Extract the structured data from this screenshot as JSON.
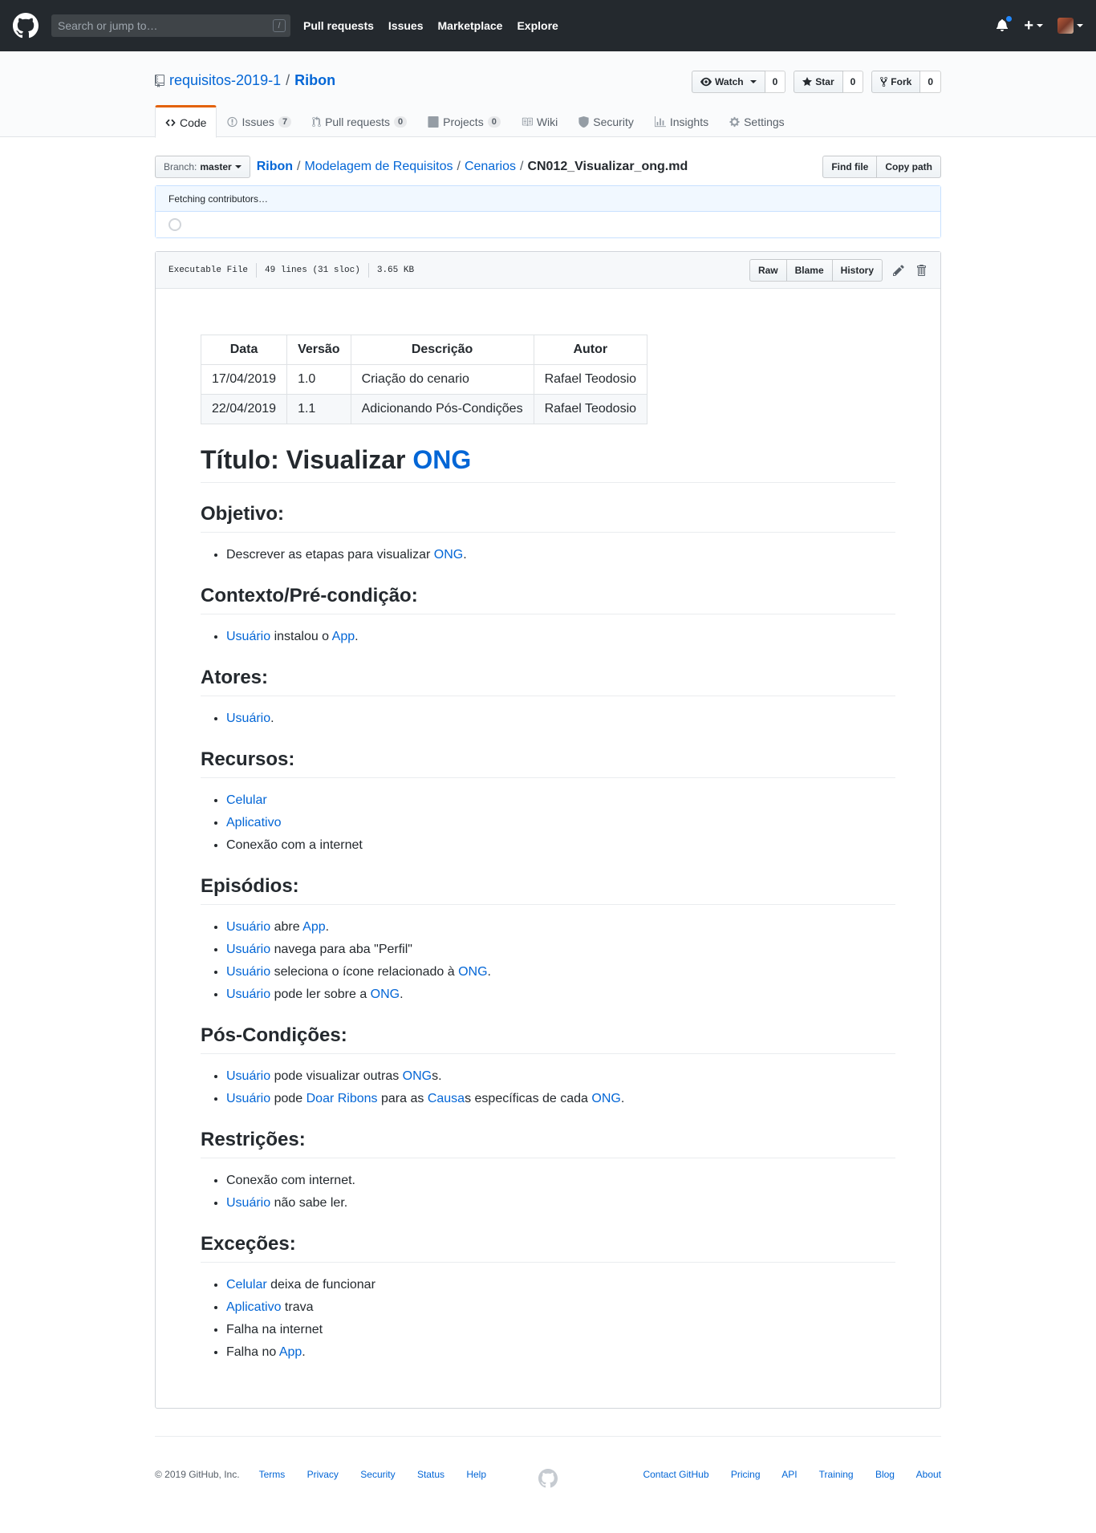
{
  "header": {
    "search_placeholder": "Search or jump to…",
    "search_key": "/",
    "nav": [
      "Pull requests",
      "Issues",
      "Marketplace",
      "Explore"
    ]
  },
  "repo": {
    "owner": "requisitos-2019-1",
    "separator": "/",
    "name": "Ribon",
    "watch_label": "Watch",
    "watch_count": "0",
    "star_label": "Star",
    "star_count": "0",
    "fork_label": "Fork",
    "fork_count": "0",
    "tabs": [
      {
        "label": "Code",
        "icon": "code-icon"
      },
      {
        "label": "Issues",
        "count": "7",
        "icon": "issue-icon"
      },
      {
        "label": "Pull requests",
        "count": "0",
        "icon": "pull-request-icon"
      },
      {
        "label": "Projects",
        "count": "0",
        "icon": "project-icon"
      },
      {
        "label": "Wiki",
        "icon": "book-icon"
      },
      {
        "label": "Security",
        "icon": "shield-icon"
      },
      {
        "label": "Insights",
        "icon": "graph-icon"
      },
      {
        "label": "Settings",
        "icon": "gear-icon"
      }
    ]
  },
  "file_nav": {
    "branch_prefix": "Branch:",
    "branch": "master",
    "path": [
      "Ribon",
      "Modelagem de Requisitos",
      "Cenarios"
    ],
    "sep": "/",
    "file": "CN012_Visualizar_ong.md",
    "find_file": "Find file",
    "copy_path": "Copy path",
    "fetching": "Fetching contributors…"
  },
  "file_header": {
    "mode": "Executable File",
    "lines": "49 lines (31 sloc)",
    "size": "3.65 KB",
    "raw": "Raw",
    "blame": "Blame",
    "history": "History"
  },
  "doc": {
    "table": {
      "headers": [
        "Data",
        "Versão",
        "Descrição",
        "Autor"
      ],
      "rows": [
        [
          "17/04/2019",
          "1.0",
          "Criação do cenario",
          "Rafael Teodosio"
        ],
        [
          "22/04/2019",
          "1.1",
          "Adicionando Pós-Condições",
          "Rafael Teodosio"
        ]
      ]
    },
    "title_prefix": "Título: Visualizar ",
    "title_link": "ONG",
    "sections": [
      {
        "heading": "Objetivo:",
        "items": [
          [
            [
              "t",
              "Descrever as etapas para visualizar "
            ],
            [
              "a",
              "ONG"
            ],
            [
              "t",
              "."
            ]
          ]
        ]
      },
      {
        "heading": "Contexto/Pré-condição:",
        "items": [
          [
            [
              "a",
              "Usuário"
            ],
            [
              "t",
              " instalou o "
            ],
            [
              "a",
              "App"
            ],
            [
              "t",
              "."
            ]
          ]
        ]
      },
      {
        "heading": "Atores:",
        "items": [
          [
            [
              "a",
              "Usuário"
            ],
            [
              "t",
              "."
            ]
          ]
        ]
      },
      {
        "heading": "Recursos:",
        "items": [
          [
            [
              "a",
              "Celular"
            ]
          ],
          [
            [
              "a",
              "Aplicativo"
            ]
          ],
          [
            [
              "t",
              "Conexão com a internet"
            ]
          ]
        ]
      },
      {
        "heading": "Episódios:",
        "items": [
          [
            [
              "a",
              "Usuário"
            ],
            [
              "t",
              " abre "
            ],
            [
              "a",
              "App"
            ],
            [
              "t",
              "."
            ]
          ],
          [
            [
              "a",
              "Usuário"
            ],
            [
              "t",
              " navega para aba \"Perfil\""
            ]
          ],
          [
            [
              "a",
              "Usuário"
            ],
            [
              "t",
              " seleciona o ícone relacionado à "
            ],
            [
              "a",
              "ONG"
            ],
            [
              "t",
              "."
            ]
          ],
          [
            [
              "a",
              "Usuário"
            ],
            [
              "t",
              " pode ler sobre a "
            ],
            [
              "a",
              "ONG"
            ],
            [
              "t",
              "."
            ]
          ]
        ]
      },
      {
        "heading": "Pós-Condições:",
        "items": [
          [
            [
              "a",
              "Usuário"
            ],
            [
              "t",
              " pode visualizar outras "
            ],
            [
              "a",
              "ONG"
            ],
            [
              "t",
              "s."
            ]
          ],
          [
            [
              "a",
              "Usuário"
            ],
            [
              "t",
              " pode "
            ],
            [
              "a",
              "Doar Ribons"
            ],
            [
              "t",
              " para as "
            ],
            [
              "a",
              "Causa"
            ],
            [
              "t",
              "s específicas de cada "
            ],
            [
              "a",
              "ONG"
            ],
            [
              "t",
              "."
            ]
          ]
        ]
      },
      {
        "heading": "Restrições:",
        "items": [
          [
            [
              "t",
              "Conexão com internet."
            ]
          ],
          [
            [
              "a",
              "Usuário"
            ],
            [
              "t",
              " não sabe ler."
            ]
          ]
        ]
      },
      {
        "heading": "Exceções:",
        "items": [
          [
            [
              "a",
              "Celular"
            ],
            [
              "t",
              " deixa de funcionar"
            ]
          ],
          [
            [
              "a",
              "Aplicativo"
            ],
            [
              "t",
              " trava"
            ]
          ],
          [
            [
              "t",
              "Falha na internet"
            ]
          ],
          [
            [
              "t",
              "Falha no "
            ],
            [
              "a",
              "App"
            ],
            [
              "t",
              "."
            ]
          ]
        ]
      }
    ]
  },
  "footer": {
    "copyright": "© 2019 GitHub, Inc.",
    "left_links": [
      "Terms",
      "Privacy",
      "Security",
      "Status",
      "Help"
    ],
    "right_links": [
      "Contact GitHub",
      "Pricing",
      "API",
      "Training",
      "Blog",
      "About"
    ]
  },
  "colors": {
    "header_bg": "#24292e",
    "link": "#0366d6",
    "tab_accent": "#e36209",
    "notification": "#2188ff"
  }
}
